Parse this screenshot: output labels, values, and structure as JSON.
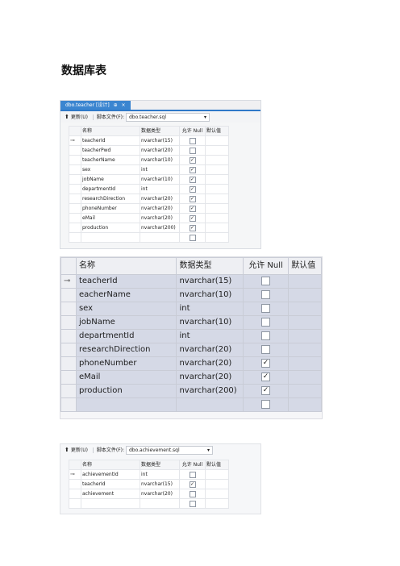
{
  "page_title": "数据库表",
  "panel1": {
    "tab_label": "dbo.teacher [设计]",
    "tab_pin": "⊕",
    "tab_close": "×",
    "update_label": "更新(U)",
    "script_file_label": "脚本文件(F):",
    "script_file_value": "dbo.teacher.sql",
    "columns": [
      "名称",
      "数据类型",
      "允许 Null",
      "默认值"
    ],
    "rows": [
      {
        "key": true,
        "name": "teacherId",
        "type": "nvarchar(15)",
        "null": false
      },
      {
        "key": false,
        "name": "teacherPwd",
        "type": "nvarchar(20)",
        "null": false
      },
      {
        "key": false,
        "name": "teacherName",
        "type": "nvarchar(10)",
        "null": true
      },
      {
        "key": false,
        "name": "sex",
        "type": "int",
        "null": true
      },
      {
        "key": false,
        "name": "jobName",
        "type": "nvarchar(10)",
        "null": true
      },
      {
        "key": false,
        "name": "departmentId",
        "type": "int",
        "null": true
      },
      {
        "key": false,
        "name": "researchDirection",
        "type": "nvarchar(20)",
        "null": true
      },
      {
        "key": false,
        "name": "phoneNumber",
        "type": "nvarchar(20)",
        "null": true
      },
      {
        "key": false,
        "name": "eMail",
        "type": "nvarchar(20)",
        "null": true
      },
      {
        "key": false,
        "name": "production",
        "type": "nvarchar(200)",
        "null": true
      }
    ]
  },
  "panel2": {
    "columns": [
      "名称",
      "数据类型",
      "允许 Null",
      "默认值"
    ],
    "rows": [
      {
        "key": true,
        "name": "teacherId",
        "type": "nvarchar(15)",
        "null": false
      },
      {
        "key": false,
        "name": "eacherName",
        "type": "nvarchar(10)",
        "null": false
      },
      {
        "key": false,
        "name": "sex",
        "type": "int",
        "null": false
      },
      {
        "key": false,
        "name": "jobName",
        "type": "nvarchar(10)",
        "null": false
      },
      {
        "key": false,
        "name": "departmentId",
        "type": "int",
        "null": false
      },
      {
        "key": false,
        "name": "researchDirection",
        "type": "nvarchar(20)",
        "null": false
      },
      {
        "key": false,
        "name": "phoneNumber",
        "type": "nvarchar(20)",
        "null": true
      },
      {
        "key": false,
        "name": "eMail",
        "type": "nvarchar(20)",
        "null": true
      },
      {
        "key": false,
        "name": "production",
        "type": "nvarchar(200)",
        "null": true
      }
    ]
  },
  "panel3": {
    "update_label": "更新(U)",
    "script_file_label": "脚本文件(F):",
    "script_file_value": "dbo.achievement.sql",
    "columns": [
      "名称",
      "数据类型",
      "允许 Null",
      "默认值"
    ],
    "rows": [
      {
        "key": true,
        "name": "achievementId",
        "type": "int",
        "null": false
      },
      {
        "key": false,
        "name": "teacherId",
        "type": "nvarchar(15)",
        "null": true
      },
      {
        "key": false,
        "name": "achievement",
        "type": "nvarchar(20)",
        "null": false
      }
    ]
  },
  "icons": {
    "key": "key-icon",
    "update": "update-arrow-icon",
    "dropdown": "chevron-down-icon",
    "check": "checkmark-icon"
  },
  "colors": {
    "tab_active": "#3b85d0",
    "selected_row": "#d5d9e6"
  }
}
